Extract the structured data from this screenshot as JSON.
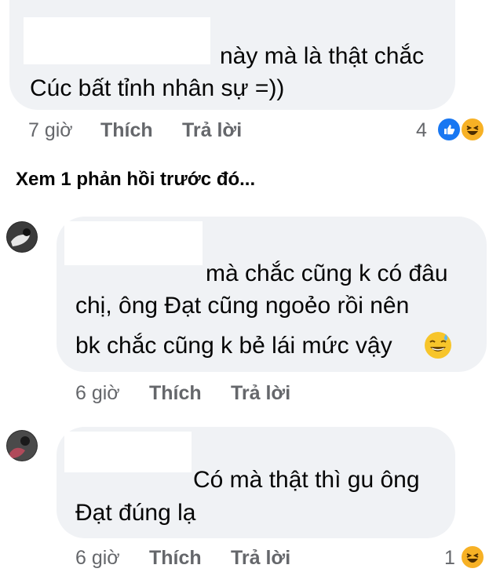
{
  "comments": [
    {
      "lines": [
        "này mà là thật chắc",
        "Cúc bất tỉnh nhân sự =))"
      ],
      "time": "7 giờ",
      "like": "Thích",
      "reply": "Trả lời",
      "reaction_count": "4",
      "reactions": [
        "like-icon",
        "haha-icon"
      ]
    },
    {
      "lines": [
        "mà chắc cũng k có đâu",
        "chị, ông Đạt cũng ngoẻo rồi nên",
        "bk chắc cũng k bẻ lái mức vậy"
      ],
      "time": "6 giờ",
      "like": "Thích",
      "reply": "Trả lời",
      "emoji": "sweat-smile-icon"
    },
    {
      "lines": [
        "Có mà thật thì gu ông",
        "Đạt đúng lạ"
      ],
      "time": "6 giờ",
      "like": "Thích",
      "reply": "Trả lời",
      "reaction_count": "1",
      "reactions": [
        "haha-icon"
      ]
    }
  ],
  "view_previous": "Xem 1 phản hồi trước đó..."
}
